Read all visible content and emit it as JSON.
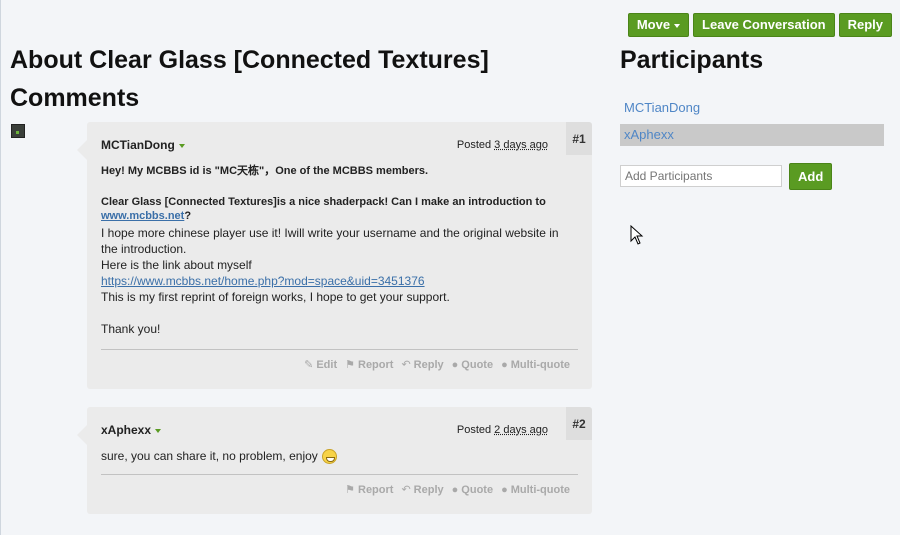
{
  "toolbar": {
    "move": "Move",
    "leave": "Leave Conversation",
    "reply": "Reply"
  },
  "page": {
    "title": "About Clear Glass [Connected Textures]",
    "comments_heading": "Comments"
  },
  "sidebar": {
    "heading": "Participants",
    "participants": [
      "MCTianDong",
      "xAphexx"
    ],
    "add_placeholder": "Add Participants",
    "add_button": "Add"
  },
  "messages": [
    {
      "number": "#1",
      "author": "MCTianDong",
      "posted_label": "Posted",
      "posted_ago": "3 days ago",
      "bold_line1": "Hey! My MCBBS id is \"MC天栋\"，One of the MCBBS members.",
      "bold_line2": "Clear Glass [Connected Textures]is a nice shaderpack! Can I make an introduction to",
      "bold_link": "www.mcbbs.net",
      "bold_suffix": "?",
      "para1": "I hope more chinese player use it! Iwill write your username and the original website in the introduction.",
      "para2": "Here is the link about myself",
      "link": "https://www.mcbbs.net/home.php?mod=space&uid=3451376",
      "para3": "This is my first reprint of foreign works, I hope to get your support.",
      "para4": "Thank you!",
      "actions": {
        "edit": "Edit",
        "report": "Report",
        "reply": "Reply",
        "quote": "Quote",
        "multiquote": "Multi-quote"
      }
    },
    {
      "number": "#2",
      "author": "xAphexx",
      "posted_label": "Posted",
      "posted_ago": "2 days ago",
      "text": "sure, you can share it, no problem, enjoy",
      "actions": {
        "report": "Report",
        "reply": "Reply",
        "quote": "Quote",
        "multiquote": "Multi-quote"
      }
    }
  ]
}
